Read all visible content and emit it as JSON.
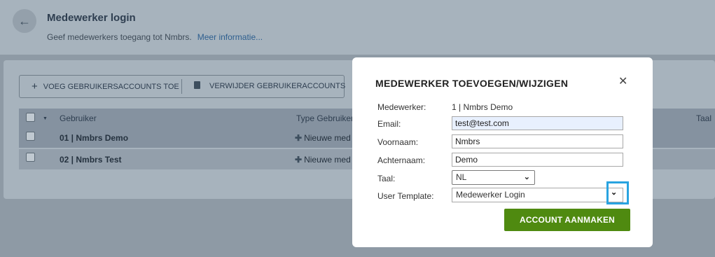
{
  "header": {
    "back_icon": "arrow-left-icon",
    "title": "Medewerker login",
    "subtitle": "Geef medewerkers toegang tot Nmbrs.",
    "more_link": "Meer informatie..."
  },
  "toolbar": {
    "add_label": "VOEG GEBRUIKERSACCOUNTS TOE",
    "remove_label": "VERWIJDER GEBRUIKERACCOUNTS"
  },
  "table": {
    "columns": [
      "Gebruiker",
      "Type Gebruiker",
      "Taal"
    ],
    "rows": [
      {
        "user": "01 | Nmbrs Demo",
        "type": "Nieuwe med"
      },
      {
        "user": "02 | Nmbrs Test",
        "type": "Nieuwe med"
      }
    ]
  },
  "modal": {
    "title": "MEDEWERKER TOEVOEGEN/WIJZIGEN",
    "fields": {
      "medewerker_label": "Medewerker:",
      "medewerker_value": "1 | Nmbrs Demo",
      "email_label": "Email:",
      "email_value": "test@test.com",
      "voornaam_label": "Voornaam:",
      "voornaam_value": "Nmbrs",
      "achternaam_label": "Achternaam:",
      "achternaam_value": "Demo",
      "taal_label": "Taal:",
      "taal_value": "NL",
      "template_label": "User Template:",
      "template_value": "Medewerker Login"
    },
    "submit_label": "ACCOUNT AANMAKEN",
    "accent_color": "#4f8a10",
    "highlight_color": "#29a3e0"
  }
}
